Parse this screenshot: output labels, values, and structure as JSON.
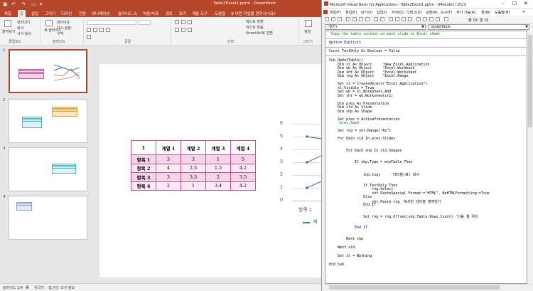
{
  "ppt": {
    "title": "Table2Excel1.pptm  -  PowerPoint",
    "tabs": [
      "파일",
      "홈",
      "삽입",
      "그리기",
      "디자인",
      "전환",
      "애니메이션",
      "슬라이드 쇼",
      "녹음/녹화",
      "검토",
      "보기",
      "개발 도구",
      "도움말",
      "♀ 어떤 작업을 원하시나요?"
    ],
    "ribbon": {
      "paste": "붙여넣기",
      "cut": "잘라내기",
      "copy": "복사",
      "format_painter": "서식 복사",
      "clipboard_group": "클립보드",
      "new_slide": "새\n슬라이드",
      "layout": "레이아웃",
      "reset": "다시 설정",
      "section": "구역",
      "slides_group": "슬라이드",
      "font_group": "글꼴",
      "paragraph_group": "단락",
      "text_dir": "텍스트 방향",
      "align_text": "텍스트 맞춤",
      "smartart": "SmartArt로 변환",
      "arrange": "정렬",
      "drawing_group": "그리기"
    },
    "thumb_numbers": [
      "1",
      "2",
      "3",
      "4"
    ],
    "slide_table": {
      "header": [
        "1",
        "계열 1",
        "계열 2",
        "계열 3",
        "계열 4"
      ],
      "rows": [
        [
          "항목 1",
          "3",
          "3",
          "1",
          "5"
        ],
        [
          "항목 2",
          "4",
          "2.5",
          "1.5",
          "4.2"
        ],
        [
          "항목 3",
          "3",
          "3.5",
          "2",
          "3.5"
        ],
        [
          "항목 4",
          "2",
          "1",
          "3.4",
          "4.2"
        ]
      ]
    },
    "chart_partial": {
      "yticks": [
        "6",
        "5",
        "4",
        "3",
        "2",
        "1",
        "0"
      ],
      "xlabel_visible": "항목 1",
      "legend_visible": "계"
    },
    "status": {
      "slide": "슬라이드 1/4",
      "lang": "한국어",
      "access": "접근성: 조사 필요"
    }
  },
  "vba": {
    "title": "Microsoft Visual Basic for Applications - Table2Excel1.pptm - [Module1 (코드)]",
    "menu": [
      "파일(F)",
      "편집(E)",
      "보기(V)",
      "삽입(I)",
      "서식(O)",
      "디버그(D)",
      "실행(R)",
      "도구(T)",
      "추가 기능(A)",
      "창(W)",
      "도움말(H)"
    ],
    "cursor_pos": "줄 19, 열 18",
    "combo_left": "(일반)",
    "combo_right": "UpdatTable",
    "code": [
      "'Copy the table content on each slide to Excel sheet",
      "",
      "Option Explicit",
      "",
      "Const TextOnly As Boolean = False",
      "",
      "Sub UpdatTable()",
      "    Dim xl As Object     'New Excel.Application",
      "    Dim wb As Object     'Excel.Workbook",
      "    Dim sht As Object    'Excel.Worksheet",
      "    Dim rng As Object    'Excel.Range",
      "",
      "    Set xl = CreateObject(\"Excel.Application\")",
      "    xl.Visible = True",
      "    Set wb = xl.Workbooks.Add",
      "    Set sht = wb.Worksheets(1)",
      "",
      "    Dim pres As Presentation",
      "    Dim sld As Slide",
      "    Dim shp As Shape",
      "",
      "    Set pres = ActivePresentation",
      "    'pres.Save",
      "",
      "    Set rng = sht.Range(\"A1\")",
      "",
      "    For Each sld In pres.Slides",
      "",
      "        For Each shp In sld.Shapes",
      "",
      "            If shp.Type = msoTable Then",
      "",
      "                shp.Copy     '테이블(표) 복사",
      "",
      "                If TextOnly Then",
      "                    rng.Select",
      "                    sht.PasteSpecial Format:=\"HTML\", NoHTMLFormatting:=True",
      "                Else",
      "                    sht.Paste rng '복사한 테이블 붙여넣기",
      "                End If",
      "",
      "                Set rng = rng.Offset(shp.Table.Rows.Count) '다음 셀 위치",
      "",
      "            End If",
      "",
      "        Next shp",
      "",
      "    Next sld",
      "",
      "    Set xl = Nothing",
      "",
      "End Sub"
    ]
  },
  "colors": {
    "ppt_accent": "#b7472a",
    "table_border": "#d24d9a",
    "table_fill": "#f4d4e7",
    "code_comment": "#008000",
    "code_keyword": "#00007f"
  }
}
